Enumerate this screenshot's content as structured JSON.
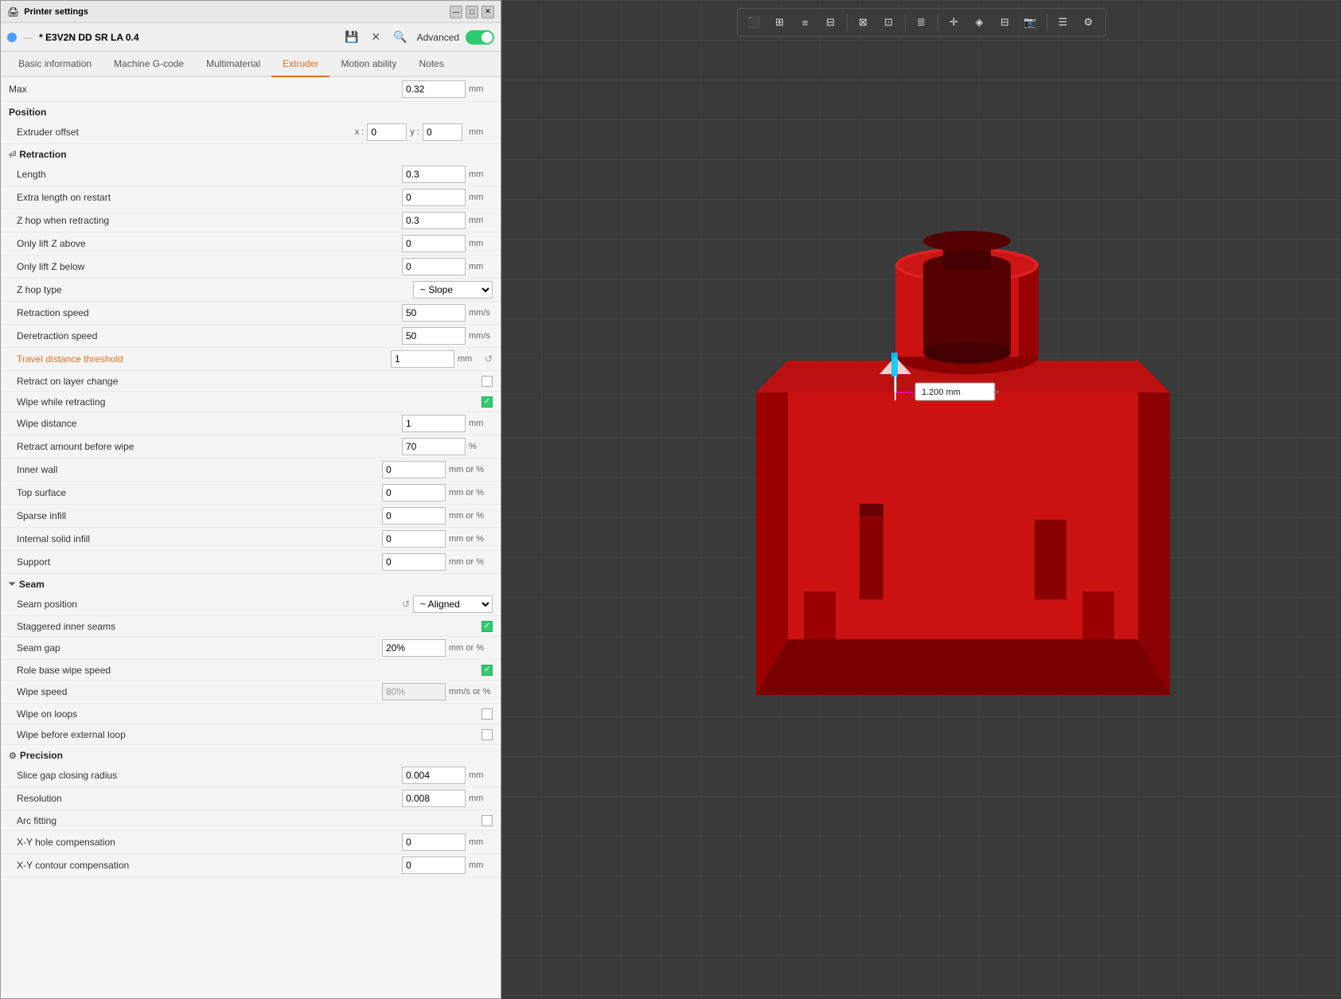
{
  "window": {
    "title": "Printer settings"
  },
  "toolbar": {
    "profile_name": "* E3V2N DD SR LA 0.4",
    "advanced_label": "Advanced",
    "toggle_on": true,
    "save_icon": "💾",
    "close_icon": "✕",
    "search_icon": "🔍"
  },
  "tabs": [
    {
      "label": "Basic information",
      "active": false
    },
    {
      "label": "Machine G-code",
      "active": false
    },
    {
      "label": "Multimaterial",
      "active": false
    },
    {
      "label": "Extruder",
      "active": true
    },
    {
      "label": "Motion ability",
      "active": false
    },
    {
      "label": "Notes",
      "active": false
    }
  ],
  "sections": {
    "max": {
      "label": "Max",
      "value": "0.32",
      "unit": "mm"
    },
    "position": {
      "header": "Position",
      "extruder_offset": {
        "label": "Extruder offset",
        "x": "0",
        "y": "0",
        "unit": "mm"
      }
    },
    "retraction": {
      "header": "Retraction",
      "fields": [
        {
          "label": "Length",
          "value": "0.3",
          "unit": "mm"
        },
        {
          "label": "Extra length on restart",
          "value": "0",
          "unit": "mm"
        },
        {
          "label": "Z hop when retracting",
          "value": "0.3",
          "unit": "mm"
        },
        {
          "label": "Only lift Z above",
          "value": "0",
          "unit": "mm"
        },
        {
          "label": "Only lift Z below",
          "value": "0",
          "unit": "mm"
        },
        {
          "label": "Z hop type",
          "value": "~ Slope",
          "type": "select"
        },
        {
          "label": "Retraction speed",
          "value": "50",
          "unit": "mm/s"
        },
        {
          "label": "Deretraction speed",
          "value": "50",
          "unit": "mm/s"
        },
        {
          "label": "Travel distance threshold",
          "value": "1",
          "unit": "mm",
          "orange": true,
          "has_reset": true
        },
        {
          "label": "Retract on layer change",
          "type": "checkbox",
          "checked": false
        },
        {
          "label": "Wipe while retracting",
          "type": "checkbox_teal",
          "checked": true
        },
        {
          "label": "Wipe distance",
          "value": "1",
          "unit": "mm"
        },
        {
          "label": "Retract amount before wipe",
          "value": "70",
          "unit": "%"
        }
      ]
    },
    "pressure_advance": {
      "fields": [
        {
          "label": "Inner wall",
          "value": "0",
          "unit": "mm or %"
        },
        {
          "label": "Top surface",
          "value": "0",
          "unit": "mm or %"
        },
        {
          "label": "Sparse infill",
          "value": "0",
          "unit": "mm or %"
        },
        {
          "label": "Internal solid infill",
          "value": "0",
          "unit": "mm or %"
        },
        {
          "label": "Support",
          "value": "0",
          "unit": "mm or %"
        }
      ]
    },
    "seam": {
      "header": "Seam",
      "fields": [
        {
          "label": "Seam position",
          "value": "~ Aligned",
          "type": "select_with_reset"
        },
        {
          "label": "Staggered inner seams",
          "type": "checkbox_teal",
          "checked": true
        },
        {
          "label": "Seam gap",
          "value": "20%",
          "unit": "mm or %"
        },
        {
          "label": "Role base wipe speed",
          "type": "checkbox_teal",
          "checked": true
        },
        {
          "label": "Wipe speed",
          "value": "80%",
          "unit": "mm/s or %",
          "disabled": true
        },
        {
          "label": "Wipe on loops",
          "type": "checkbox",
          "checked": false
        },
        {
          "label": "Wipe before external loop",
          "type": "checkbox",
          "checked": false
        }
      ]
    },
    "precision": {
      "header": "Precision",
      "fields": [
        {
          "label": "Slice gap closing radius",
          "value": "0.004",
          "unit": "mm"
        },
        {
          "label": "Resolution",
          "value": "0.008",
          "unit": "mm"
        },
        {
          "label": "Arc fitting",
          "type": "checkbox",
          "checked": false
        },
        {
          "label": "X-Y hole compensation",
          "value": "0",
          "unit": "mm"
        },
        {
          "label": "X-Y contour compensation",
          "value": "0",
          "unit": "mm"
        }
      ]
    }
  },
  "viewport": {
    "measurement": "1.200 mm",
    "toolbar_buttons": [
      "cube",
      "grid",
      "layers",
      "table",
      "sep",
      "layers2",
      "layers3",
      "sep",
      "stack",
      "sep",
      "move",
      "paint",
      "slice",
      "camera",
      "sep",
      "list",
      "settings"
    ]
  }
}
